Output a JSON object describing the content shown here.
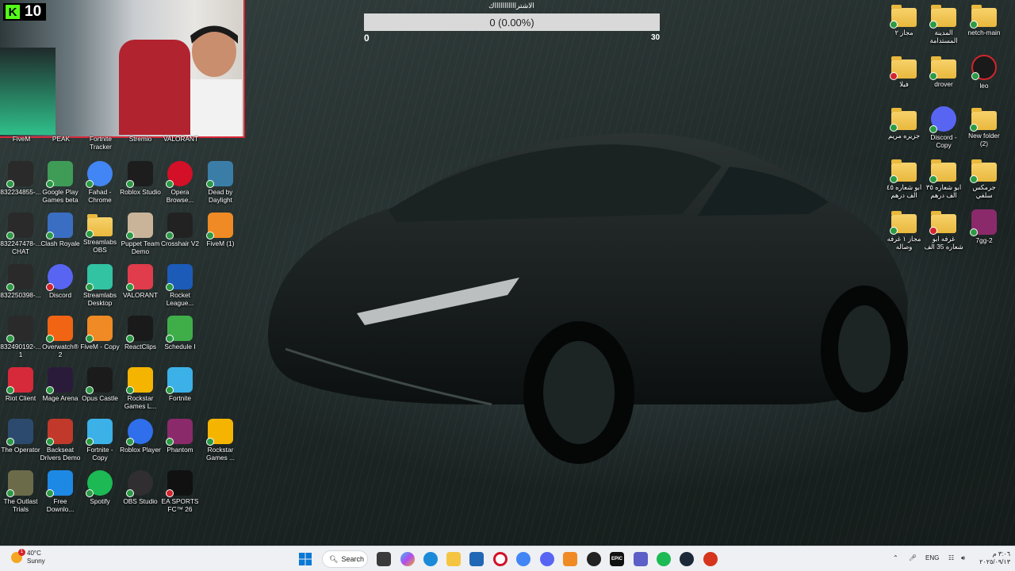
{
  "webcam": {
    "kick_count": "10"
  },
  "goal": {
    "title": "الاشتراااااااااااك",
    "progress_text": "0 (0.00%)",
    "progress_fraction": 0,
    "min": "0",
    "max": "30"
  },
  "desktop_left": {
    "partial_row": [
      "FiveM",
      "PEAK",
      "Fortnite Tracker",
      "Stremio",
      "VALORANT"
    ],
    "icons": [
      {
        "label": "832234855-...",
        "icon": "unknown-file-icon",
        "color": "#2a2a2a"
      },
      {
        "label": "Google Play Games beta",
        "icon": "google-play-games-icon",
        "color": "#3f9c57"
      },
      {
        "label": "Fahad - Chrome",
        "icon": "chrome-icon",
        "color": "#4285f4"
      },
      {
        "label": "Roblox Studio",
        "icon": "roblox-studio-icon",
        "color": "#1d1d1d"
      },
      {
        "label": "Opera Browse...",
        "icon": "opera-icon",
        "color": "#d31027"
      },
      {
        "label": "Dead by Daylight",
        "icon": "dead-by-daylight-icon",
        "color": "#3a7ea8"
      },
      {
        "label": "832247478-... CHAT",
        "icon": "chat-file-icon",
        "color": "#2a2a2a"
      },
      {
        "label": "Clash Royale",
        "icon": "clash-royale-icon",
        "color": "#3a6ec2"
      },
      {
        "label": "Streamlabs OBS",
        "icon": "folder-icon",
        "color": "#e9b83d"
      },
      {
        "label": "Puppet Team Demo",
        "icon": "puppet-team-icon",
        "color": "#c9b49a"
      },
      {
        "label": "Crosshair V2",
        "icon": "crosshair-icon",
        "color": "#222222"
      },
      {
        "label": "FiveM (1)",
        "icon": "fivem-icon",
        "color": "#f08a24"
      },
      {
        "label": "832250398-...",
        "icon": "unknown-file-icon",
        "color": "#2a2a2a"
      },
      {
        "label": "Discord",
        "icon": "discord-icon",
        "color": "#5865f2"
      },
      {
        "label": "Streamlabs Desktop",
        "icon": "streamlabs-icon",
        "color": "#31c3a2"
      },
      {
        "label": "VALORANT",
        "icon": "valorant-icon",
        "color": "#e03c4c"
      },
      {
        "label": "Rocket League...",
        "icon": "rocket-league-icon",
        "color": "#1c5bb8"
      },
      {
        "label": "",
        "icon": "none",
        "color": "transparent"
      },
      {
        "label": "832490192-... 1",
        "icon": "unknown-file-icon",
        "color": "#2a2a2a"
      },
      {
        "label": "Overwatch® 2",
        "icon": "overwatch-icon",
        "color": "#f06414"
      },
      {
        "label": "FiveM - Copy",
        "icon": "fivem-icon",
        "color": "#f08a24"
      },
      {
        "label": "ReactClips",
        "icon": "reactclips-icon",
        "color": "#1a1a1a"
      },
      {
        "label": "Schedule I",
        "icon": "schedule-one-icon",
        "color": "#3fae49"
      },
      {
        "label": "",
        "icon": "none",
        "color": "transparent"
      },
      {
        "label": "Riot Client",
        "icon": "riot-client-icon",
        "color": "#d6293a"
      },
      {
        "label": "Mage Arena",
        "icon": "mage-arena-icon",
        "color": "#2b1b3b"
      },
      {
        "label": "Opus Castle",
        "icon": "opus-castle-icon",
        "color": "#1b1b1b"
      },
      {
        "label": "Rockstar Games L...",
        "icon": "rockstar-icon",
        "color": "#f4b400"
      },
      {
        "label": "Fortnite",
        "icon": "fortnite-icon",
        "color": "#3bb1e8"
      },
      {
        "label": "",
        "icon": "none",
        "color": "transparent"
      },
      {
        "label": "The Operator",
        "icon": "the-operator-icon",
        "color": "#2c4a6e"
      },
      {
        "label": "Backseat Drivers Demo",
        "icon": "backseat-drivers-icon",
        "color": "#c0392b"
      },
      {
        "label": "Fortnite - Copy",
        "icon": "fortnite-icon",
        "color": "#3bb1e8"
      },
      {
        "label": "Roblox Player",
        "icon": "roblox-icon",
        "color": "#2f6fec"
      },
      {
        "label": "Phantom",
        "icon": "winrar-icon",
        "color": "#8b2a6b"
      },
      {
        "label": "Rockstar Games ...",
        "icon": "rockstar-icon",
        "color": "#f4b400"
      },
      {
        "label": "The Outlast Trials",
        "icon": "outlast-icon",
        "color": "#6b6b4a"
      },
      {
        "label": "Free Downlo...",
        "icon": "free-download-icon",
        "color": "#1e88e5"
      },
      {
        "label": "Spotify",
        "icon": "spotify-icon",
        "color": "#1db954"
      },
      {
        "label": "OBS Studio",
        "icon": "obs-icon",
        "color": "#302e31"
      },
      {
        "label": "EA SPORTS FC™ 26",
        "icon": "ea-sports-fc-icon",
        "color": "#111111"
      }
    ]
  },
  "desktop_right": {
    "icons": [
      {
        "label": "مجاز ٢",
        "icon": "folder-icon"
      },
      {
        "label": "المدينة المستدامة",
        "icon": "folder-icon"
      },
      {
        "label": "netch-main",
        "icon": "folder-icon"
      },
      {
        "label": "فيلا",
        "icon": "folder-icon"
      },
      {
        "label": "drover",
        "icon": "folder-icon"
      },
      {
        "label": "leo",
        "icon": "leo-app-icon"
      },
      {
        "label": "جزيره مريم",
        "icon": "folder-icon"
      },
      {
        "label": "Discord - Copy",
        "icon": "discord-icon"
      },
      {
        "label": "New folder (2)",
        "icon": "folder-icon"
      },
      {
        "label": "ابو شعاره ٤٥ الف درهم",
        "icon": "folder-icon"
      },
      {
        "label": "ابو شعاره ٣٥ الف درهم",
        "icon": "folder-icon"
      },
      {
        "label": "جرمكس سلفي",
        "icon": "folder-icon"
      },
      {
        "label": "مجاز ١ غرفه وصاله",
        "icon": "folder-icon"
      },
      {
        "label": "غرفه ابو شعاره 35 الف",
        "icon": "folder-icon"
      },
      {
        "label": "7gg-2",
        "icon": "winrar-icon"
      }
    ]
  },
  "taskbar": {
    "weather_temp": "40°C",
    "weather_desc": "Sunny",
    "weather_badge": "1",
    "search_label": "Search",
    "language": "ENG",
    "clock_time": "٣:٠٦ م",
    "clock_date": "٢٠٢٥/٠٩/١٣"
  }
}
